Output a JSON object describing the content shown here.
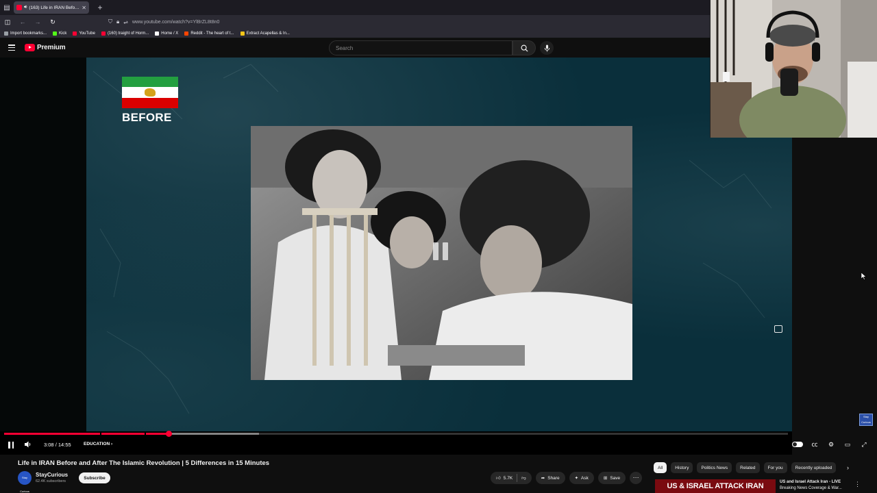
{
  "browser": {
    "tab_title": "(163) Life in IRAN Before an",
    "url": "www.youtube.com/watch?v=YlBrZL8t8n0",
    "bookmarks": [
      {
        "label": "Import bookmarks...",
        "color": "#9aa0a6"
      },
      {
        "label": "Kick",
        "color": "#53fc18"
      },
      {
        "label": "YouTube",
        "color": "#ff0033"
      },
      {
        "label": "(160) traight of Horm...",
        "color": "#ff0033"
      },
      {
        "label": "Home / X",
        "color": "#ffffff"
      },
      {
        "label": "Reddit - The heart of t...",
        "color": "#ff4500"
      },
      {
        "label": "Extract Acapellas & In...",
        "color": "#f5c518"
      }
    ]
  },
  "header": {
    "logo_text": "Premium",
    "search_placeholder": "Search"
  },
  "video": {
    "overlay_label": "BEFORE",
    "current_time": "3:08",
    "separator": "/",
    "duration": "14:55",
    "chapter": "EDUCATION",
    "progress_fraction": 0.21,
    "buffered_fraction": 0.325,
    "channel_watermark": "Stay Curious"
  },
  "info": {
    "title": "Life in IRAN Before and After The Islamic Revolution | 5 Differences in 15 Minutes",
    "channel_name": "StayCurious",
    "channel_avatar_text": "Stay Curious",
    "subscribers": "62.4K subscribers",
    "subscribe_label": "Subscribe",
    "likes": "5.7K",
    "share_label": "Share",
    "ask_label": "Ask",
    "save_label": "Save"
  },
  "chips": [
    "All",
    "History",
    "Politics News",
    "Related",
    "For you",
    "Recently uploaded"
  ],
  "recommendation": {
    "thumb_text": "US & ISRAEL ATTACK IRAN",
    "title_line1": "US and Israel Attack Iran - LIVE",
    "title_line2": "Breaking News Coverage & War..."
  },
  "colors": {
    "accent": "#ff0033",
    "frame_bg": "#0a2f3b"
  }
}
